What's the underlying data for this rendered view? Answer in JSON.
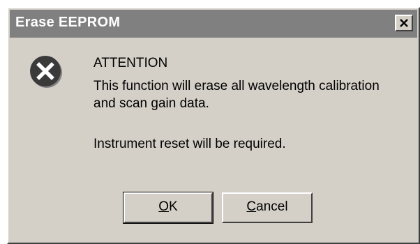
{
  "window": {
    "title": "Erase EEPROM",
    "close_icon": "close-icon"
  },
  "message": {
    "icon": "error-icon",
    "heading": "ATTENTION",
    "body": "This function will erase all wavelength calibration and scan gain data.",
    "note": "Instrument reset will be required."
  },
  "buttons": {
    "ok": {
      "mnemonic": "O",
      "rest": "K"
    },
    "cancel": {
      "mnemonic": "C",
      "rest": "ancel"
    }
  },
  "colors": {
    "dialog_face": "#d4d0c8",
    "titlebar_inactive": "#808080",
    "title_text": "#ffffff",
    "error_icon": "#3a3a3a"
  }
}
